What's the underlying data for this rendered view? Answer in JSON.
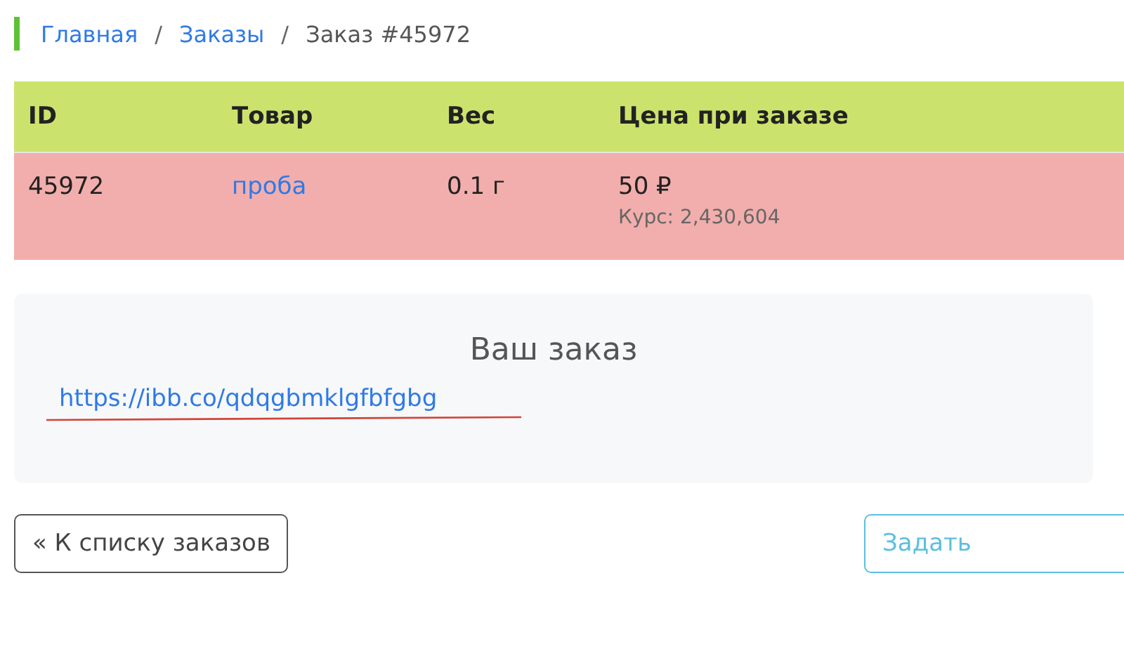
{
  "breadcrumb": [
    {
      "label": "Главная",
      "kind": "link"
    },
    {
      "label": "Заказы",
      "kind": "link"
    },
    {
      "label": "Заказ #45972",
      "kind": "current"
    }
  ],
  "breadcrumb_separator": "/",
  "table": {
    "columns": [
      "ID",
      "Товар",
      "Вес",
      "Цена при заказе"
    ],
    "rows": [
      {
        "id": "45972",
        "product": "проба",
        "weight": "0.1 г",
        "price": "50 ₽",
        "rate": "Курс: 2,430,604"
      }
    ]
  },
  "order_card": {
    "title": "Ваш заказ",
    "link": "https://ibb.co/qdqgbmklgfbfgbg"
  },
  "buttons": [
    {
      "label": "« К списку заказов",
      "kind": "back"
    },
    {
      "label": "Задать",
      "kind": "ask"
    }
  ]
}
